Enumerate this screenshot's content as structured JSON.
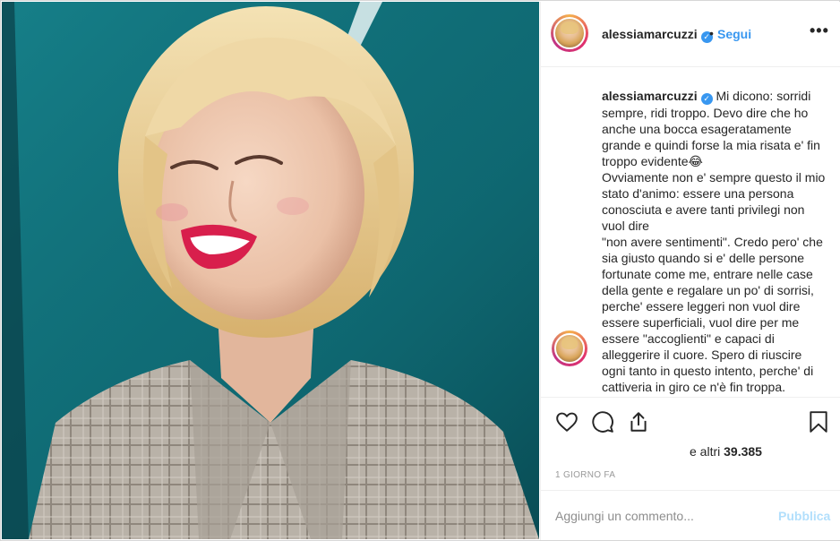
{
  "post": {
    "username": "alessiamarcuzzi",
    "verified_icon": "verified-badge-icon",
    "separator": "•",
    "follow_label": "Segui",
    "more_label": "•••"
  },
  "caption": {
    "username": "alessiamarcuzzi",
    "lines": [
      "Mi dicono: sorridi sempre, ridi troppo. Devo dire che ho anche una bocca esageratamente grande e quindi forse la mia risata e' fin troppo evidente😂",
      "Ovviamente non e' sempre questo il mio stato d'animo: essere una persona conosciuta e avere tanti privilegi non vuol dire",
      "\"non avere sentimenti\". Credo pero' che sia giusto quando si e' delle persone fortunate come me, entrare nelle case della gente e regalare un po' di sorrisi, perche' essere leggeri non vuol dire essere superficiali, vuol dire per me essere \"accoglienti\" e capaci di alleggerire il cuore. Spero di riuscire ogni tanto in questo intento, perche' di cattiveria in giro ce n'è fin troppa."
    ]
  },
  "actions": {
    "icons": [
      "heart-icon",
      "comment-icon",
      "share-icon",
      "bookmark-icon"
    ],
    "likes_prefix": "e altri",
    "likes_count": "39.385",
    "timestamp": "1 giorno fa"
  },
  "comment": {
    "placeholder": "Aggiungi un commento...",
    "publish_label": "Pubblica"
  },
  "colors": {
    "accent": "#3897f0",
    "publish_disabled": "#b2dffc",
    "text": "#262626",
    "muted": "#999999"
  }
}
